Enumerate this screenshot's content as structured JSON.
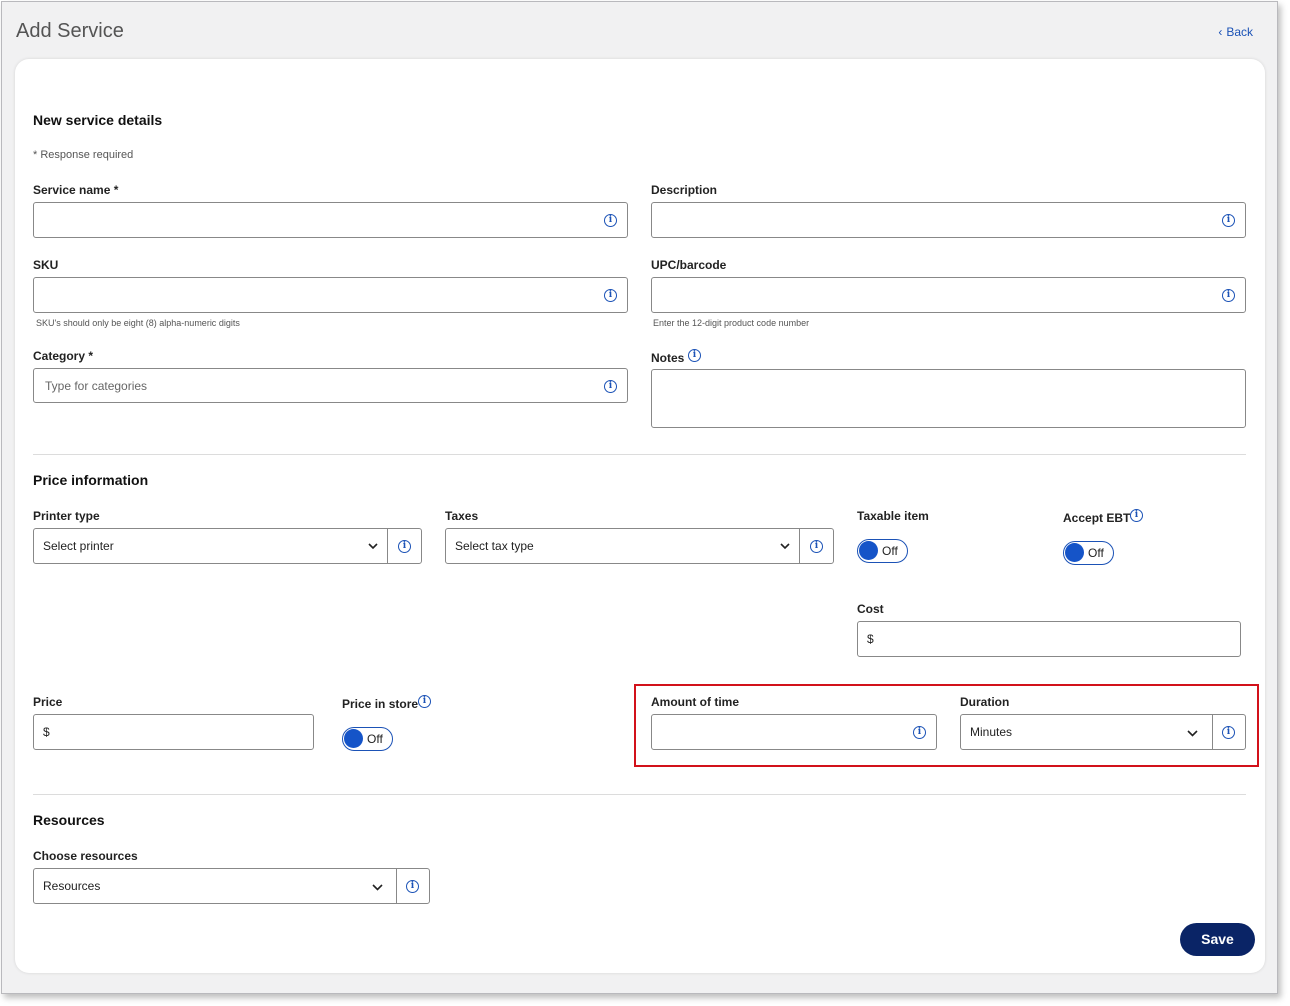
{
  "header": {
    "title": "Add Service",
    "back_label": "Back"
  },
  "details": {
    "heading": "New service details",
    "required_note": "* Response required",
    "service_name_label": "Service name *",
    "description_label": "Description",
    "sku_label": "SKU",
    "sku_hint": "SKU's should only be eight (8) alpha-numeric digits",
    "upc_label": "UPC/barcode",
    "upc_hint": "Enter the 12-digit product code number",
    "category_label": "Category *",
    "category_placeholder": "Type for categories",
    "notes_label": "Notes"
  },
  "price": {
    "heading": "Price information",
    "printer_label": "Printer type",
    "printer_value": "Select printer",
    "taxes_label": "Taxes",
    "taxes_value": "Select tax type",
    "taxable_label": "Taxable item",
    "taxable_state": "Off",
    "ebt_label": "Accept EBT",
    "ebt_state": "Off",
    "cost_label": "Cost",
    "cost_prefix": "$",
    "price_label": "Price",
    "price_prefix": "$",
    "price_in_store_label": "Price in store",
    "price_in_store_state": "Off",
    "amount_label": "Amount of time",
    "duration_label": "Duration",
    "duration_value": "Minutes"
  },
  "resources": {
    "heading": "Resources",
    "choose_label": "Choose resources",
    "value": "Resources"
  },
  "actions": {
    "save_label": "Save"
  },
  "icons": {
    "info": "info-icon",
    "chevron": "chevron-down-icon",
    "back": "chevron-left-icon"
  },
  "colors": {
    "accent": "#1b52b6",
    "save": "#0a2466",
    "highlight": "#d2111a"
  }
}
